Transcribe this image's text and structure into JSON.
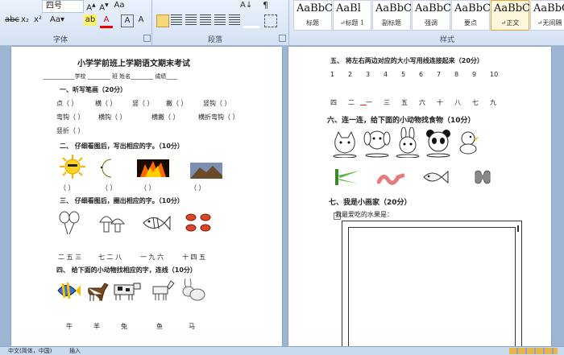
{
  "ribbon": {
    "font_name": "四号",
    "font_group_label": "字体",
    "paragraph_group_label": "段落",
    "styles_group_label": "样式",
    "styles": [
      {
        "preview": "AaBbC",
        "name": "标题"
      },
      {
        "preview": "AaBl",
        "name": "↵标题 1"
      },
      {
        "preview": "AaBbC",
        "name": "副标题"
      },
      {
        "preview": "AaBbCcD",
        "name": "强调"
      },
      {
        "preview": "AaBbCcD",
        "name": "要点"
      },
      {
        "preview": "AaBbCcD",
        "name": "↵正文"
      },
      {
        "preview": "AaBbCcD",
        "name": "↵无间隔"
      }
    ]
  },
  "left_page": {
    "title": "小学学前班上学期语文期末考试",
    "info_line": "___________学校 ________ 班  姓名________  成绩____",
    "s1": "一、听写笔画（20分）",
    "strokes_row1": [
      "点（  ）",
      "横（  ）",
      "竖（  ）",
      "撇（  ）",
      "竖钩（  ）"
    ],
    "strokes_row2": [
      "弯钩（  ）",
      "横钩（  ）",
      "横撇（  ）",
      "横折弯钩（  ）"
    ],
    "strokes_row3": [
      "竖折（  ）"
    ],
    "s2": "二、 仔细看图后，写出相应的字。（10分）",
    "s2_blanks": [
      "（    ）",
      "（    ）",
      "（    ）",
      "（    ）"
    ],
    "s3": "三、 仔细看图后，圈出相应的字。（10分）",
    "s3_options": [
      "二 五 三",
      "七 二 八",
      "一 九 六",
      "十 四 五"
    ],
    "s4": "四、 给下面的小动物找相应的字，连线（10分）",
    "s4_chars": [
      "牛",
      "羊",
      "兔",
      "鱼",
      "马"
    ]
  },
  "right_page": {
    "s5": "五、 将左右两边对应的大小写用线连接起来（20分）",
    "digits": [
      "1",
      "2",
      "3",
      "4",
      "5",
      "6",
      "7",
      "8",
      "9",
      "10"
    ],
    "chinese_nums": [
      "四",
      "二",
      "一",
      "三",
      "五",
      "六",
      "十",
      "八",
      "七",
      "九"
    ],
    "s6": "六、连一连，给下面的小动物找食物（10分）",
    "s7": "七、我是小画家（20分）",
    "s7_prompt": "我最爱吃的水果是："
  },
  "status_bar": {
    "language": "中文(简体，中国)",
    "mode": "插入"
  }
}
